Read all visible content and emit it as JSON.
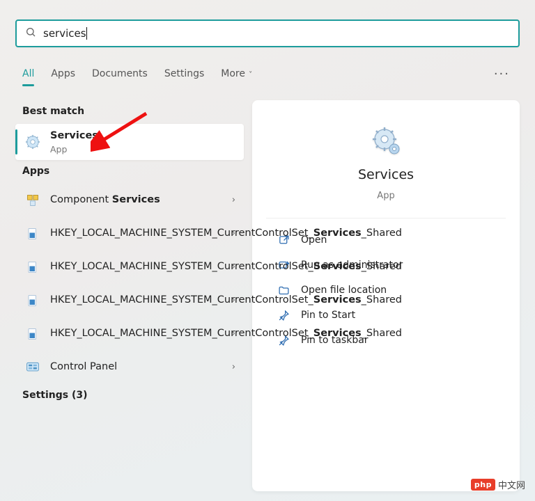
{
  "search": {
    "query": "services"
  },
  "tabs": {
    "all": "All",
    "apps": "Apps",
    "documents": "Documents",
    "settings": "Settings",
    "more": "More"
  },
  "left": {
    "best_match_header": "Best match",
    "apps_header": "Apps",
    "settings_header": "Settings (3)",
    "best_match": {
      "title_pre": "",
      "title_hl": "Services",
      "title_post": "",
      "sub": "App"
    },
    "apps": [
      {
        "title_pre": "Component ",
        "title_hl": "Services",
        "title_post": "",
        "sub": ""
      },
      {
        "title_pre": "HKEY_LOCAL_MACHINE_SYSTEM_CurrentControlSet_",
        "title_hl": "Services",
        "title_post": "_Shared",
        "sub": ""
      },
      {
        "title_pre": "HKEY_LOCAL_MACHINE_SYSTEM_CurrentControlSet_",
        "title_hl": "Services",
        "title_post": "_Shared",
        "sub": ""
      },
      {
        "title_pre": "HKEY_LOCAL_MACHINE_SYSTEM_CurrentControlSet_",
        "title_hl": "Services",
        "title_post": "_Shared",
        "sub": ""
      },
      {
        "title_pre": "HKEY_LOCAL_MACHINE_SYSTEM_CurrentControlSet_",
        "title_hl": "Services",
        "title_post": "_Shared",
        "sub": ""
      },
      {
        "title_pre": "Control Panel",
        "title_hl": "",
        "title_post": "",
        "sub": ""
      }
    ]
  },
  "right": {
    "title": "Services",
    "sub": "App",
    "actions": {
      "open": "Open",
      "admin": "Run as administrator",
      "location": "Open file location",
      "pin_start": "Pin to Start",
      "pin_taskbar": "Pin to taskbar"
    }
  },
  "watermark": {
    "badge": "php",
    "text": "中文网"
  }
}
